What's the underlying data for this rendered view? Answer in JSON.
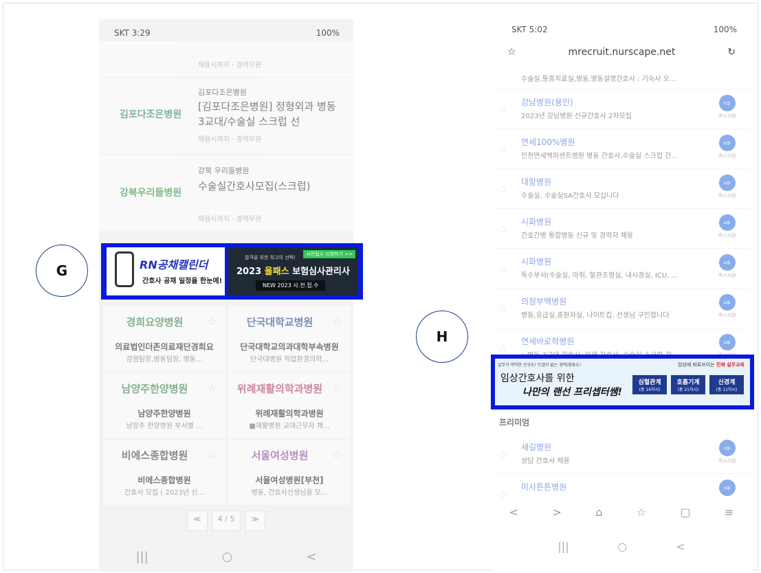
{
  "left": {
    "status": {
      "time": "SKT 3:29",
      "right": "100%"
    },
    "jobs": [
      {
        "hospital": "",
        "title": "",
        "meta": "채용시까지 · 경력무관",
        "logo": ""
      },
      {
        "hospital": "김포다조은병원",
        "title": "[김포다조은병원] 정형외과 병동 3교대/수술실 스크럽 선",
        "meta": "채용시까지 · 경력무관",
        "logo": "김포다조은병원"
      },
      {
        "hospital": "강북 우리들병원",
        "title": "수술실간호사모집(스크럽)",
        "meta": "채용시까지 · 경력무관",
        "logo": "강북우리들병원"
      }
    ],
    "grid": [
      {
        "logo": "경희요양병원",
        "name": "의료법인더존의료재단경희요",
        "sub": "감염팀장,병동팀장, 병동..."
      },
      {
        "logo": "단국대학교병원",
        "name": "단국대학교의과대학부속병원",
        "sub": "단국대병원 직업환경의학..."
      },
      {
        "logo": "남양주한양병원",
        "name": "남양주한양병원",
        "sub": "남양주 한양병원 부서별 ..."
      },
      {
        "logo": "위례재활의학과병원",
        "name": "위례재활의학과병원",
        "sub": "■재활병원 교대근무자 채..."
      },
      {
        "logo": "비에스종합병원",
        "name": "비에스종합병원",
        "sub": "간호사 모집 ( 2023년 신..."
      },
      {
        "logo": "서울여성병원",
        "name": "서울여성병원[부천]",
        "sub": "병동, 간호사선생님을 모..."
      }
    ],
    "pager": {
      "prev": "≪",
      "page": "4 / 5",
      "next": "≫"
    },
    "nav": {
      "recent": "|||",
      "home": "○",
      "back": "<"
    }
  },
  "bannerG": {
    "rn_title": "RN공채캘린더",
    "rn_sub": "간호사 공채 일정을 한눈에!",
    "b2_tag": "사전접수 신청하기 >>",
    "b2_top": "합격을 위한 최고의 선택!",
    "b2_title_prefix": "2023 ",
    "b2_title_highlight": "올패스",
    "b2_title_suffix": " 보험심사관리사",
    "b2_sub": "NEW 2023 사.전.접.수"
  },
  "labels": {
    "g": "G",
    "h": "H"
  },
  "right": {
    "status": {
      "time": "SKT 5:02",
      "right": "100%"
    },
    "url": "mrecruit.nurscape.net",
    "rows": [
      {
        "name": "",
        "desc": "수술실,통증치료실,병동,병동설명간호사 : 기숙사 오...",
        "apply": "즉시지원"
      },
      {
        "name": "강남병원(용인)",
        "desc": "2023년 강남병원 신규간호사 2차모집",
        "apply": "즉시지원"
      },
      {
        "name": "연세100%병원",
        "desc": "인천연세백퍼센트병원 병동 간호사,수술실 스크럽 간...",
        "apply": "즉시지원"
      },
      {
        "name": "대항병원",
        "desc": "수술실, 수술실SA간호사 모십니다",
        "apply": "즉시지원"
      },
      {
        "name": "시화병원",
        "desc": "간호간병 통합병동 신규 및 경력자 채용",
        "apply": "즉시지원"
      },
      {
        "name": "시화병원",
        "desc": "특수부서(수술실, 마취, 혈관조영실, 내시경실, ICU, ...",
        "apply": "즉시지원"
      },
      {
        "name": "의정부백병원",
        "desc": "병동,응급실,중환자실, 나이트킵. 선생님 구인합니다",
        "apply": "즉시지원"
      },
      {
        "name": "연세바로척병원",
        "desc": "• 병동 3교대 간호사, 외래 간호사, 수술실 스크럽 간",
        "apply": "즉시지원"
      }
    ],
    "premium": "프리미엄",
    "premium_rows": [
      {
        "name": "새길병원",
        "desc": "상담 간호사 채용",
        "apply": "즉시지원"
      },
      {
        "name": "미사튼튼병원",
        "desc": "",
        "apply": ""
      }
    ]
  },
  "bannerH": {
    "top": "실무가 막막한 신규도! 뜨겁이 없는 경력/휴튜도!",
    "right_prefix": "임상에 바로쓰이는 ",
    "right_red": "진짜 실무교육",
    "title1": "임상간호사를 위한",
    "title2": "나만의 랜선 프리셉터쌤!",
    "tags": [
      {
        "label": "심혈관계",
        "sub": "(총 14차시)"
      },
      {
        "label": "호흡기계",
        "sub": "(총 21차시)"
      },
      {
        "label": "신경계",
        "sub": "(총 11차시)"
      }
    ]
  }
}
